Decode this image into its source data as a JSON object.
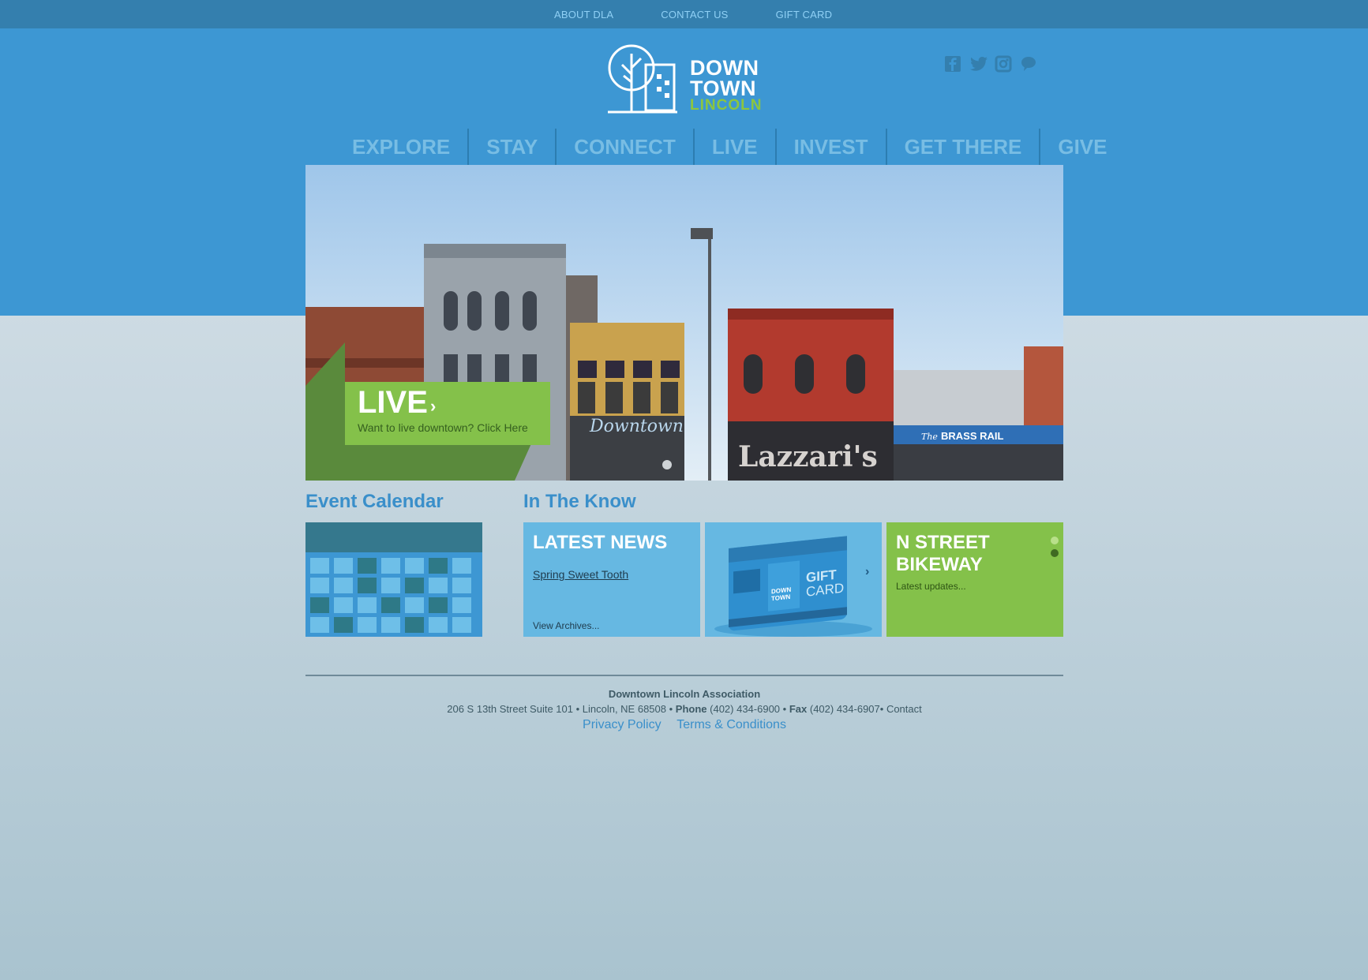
{
  "utility_nav": {
    "items": [
      "ABOUT DLA",
      "CONTACT US",
      "GIFT CARD"
    ]
  },
  "logo": {
    "line1": "DOWN",
    "line2": "TOWN",
    "line3": "LINCOLN"
  },
  "social": {
    "icons": [
      "facebook-icon",
      "twitter-icon",
      "instagram-icon",
      "chat-bubble-icon"
    ]
  },
  "main_nav": {
    "items": [
      "EXPLORE",
      "STAY",
      "CONNECT",
      "LIVE",
      "INVEST",
      "GET THERE",
      "GIVE"
    ]
  },
  "hero": {
    "title": "LIVE",
    "arrow": "›",
    "subtitle": "Want to live downtown? Click Here",
    "signs": {
      "downtown": "Downtown",
      "lazzaris": "Lazzari's",
      "brass_rail_prefix": "The",
      "brass_rail": "BRASS RAIL"
    }
  },
  "event_calendar": {
    "title": "Event Calendar"
  },
  "in_the_know": {
    "title": "In The Know",
    "latest_news": {
      "title": "LATEST NEWS",
      "headline": "Spring Sweet Tooth",
      "archive": "View Archives..."
    },
    "gift_card": {
      "card_line1": "GIFT",
      "card_line2": "CARD",
      "card_logo1": "DOWN",
      "card_logo2": "TOWN",
      "arrow": "›"
    },
    "bikeway": {
      "title_line1": "N STREET",
      "title_line2": "BIKEWAY",
      "subtitle": "Latest updates..."
    }
  },
  "footer": {
    "org": "Downtown Lincoln Association",
    "address": "206 S 13th Street  Suite 101 • Lincoln, NE 68508 •",
    "phone_label": "Phone",
    "phone": "(402) 434-6900",
    "fax_label": "Fax",
    "fax": "(402) 434-6907",
    "contact": "Contact",
    "privacy": "Privacy Policy",
    "terms": "Terms & Conditions"
  },
  "colors": {
    "primary_blue": "#3d97d3",
    "utility_bar": "#347fae",
    "accent_green": "#84c14a",
    "heading_blue": "#3a8fca"
  }
}
